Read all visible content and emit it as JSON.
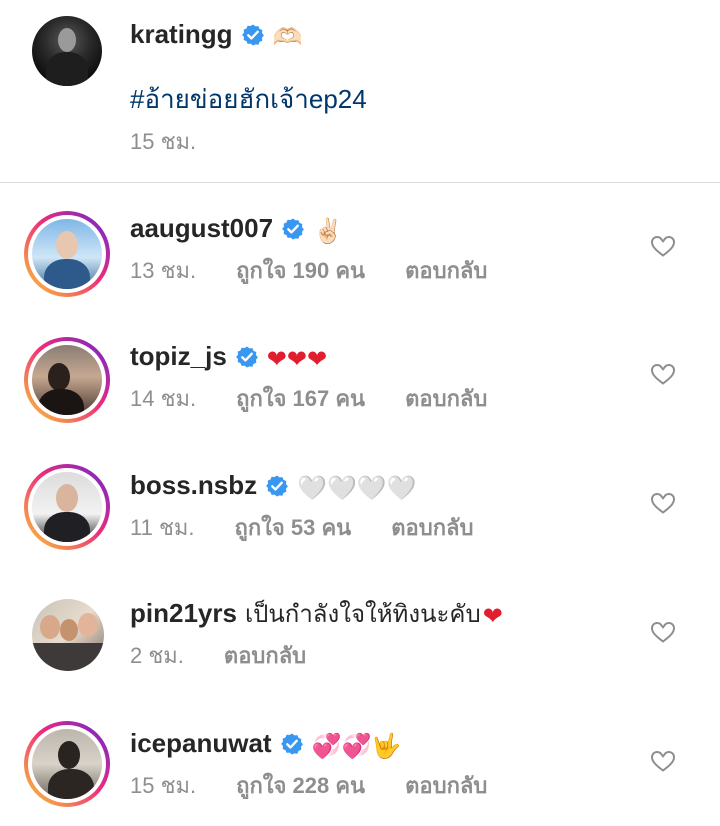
{
  "caption": {
    "username": "kratingg",
    "emoji": "🫶🏻",
    "hashtag": "#อ้ายข่อยฮักเจ้าep24",
    "time": "15 ชม."
  },
  "comments": [
    {
      "username": "aaugust007",
      "verified": true,
      "text": "",
      "emoji": "✌🏻",
      "time": "13 ชม.",
      "likes": "ถูกใจ 190 คน",
      "reply": "ตอบกลับ"
    },
    {
      "username": "topiz_js",
      "verified": true,
      "text": "",
      "emoji": "❤❤❤",
      "time": "14 ชม.",
      "likes": "ถูกใจ 167 คน",
      "reply": "ตอบกลับ"
    },
    {
      "username": "boss.nsbz",
      "verified": true,
      "text": "",
      "emoji": "🤍🤍🤍🤍",
      "time": "11 ชม.",
      "likes": "ถูกใจ 53 คน",
      "reply": "ตอบกลับ"
    },
    {
      "username": "pin21yrs",
      "verified": false,
      "text": "เป็นกำลังใจให้ทิงนะคับ",
      "emoji": "❤",
      "time": "2 ชม.",
      "likes": "",
      "reply": "ตอบกลับ"
    },
    {
      "username": "icepanuwat",
      "verified": true,
      "text": "",
      "emoji": "💞💞🤟",
      "time": "15 ชม.",
      "likes": "ถูกใจ 228 คน",
      "reply": "ตอบกลับ"
    }
  ],
  "colors": {
    "verified_badge": "#3897f0",
    "hashtag": "#00376b",
    "muted_text": "#8e8e8e",
    "ring_gradient": [
      "#f9ce34",
      "#ee2a7b",
      "#6228d7"
    ]
  },
  "icons": {
    "verified": "verified-badge-icon",
    "like": "heart-outline-icon"
  }
}
